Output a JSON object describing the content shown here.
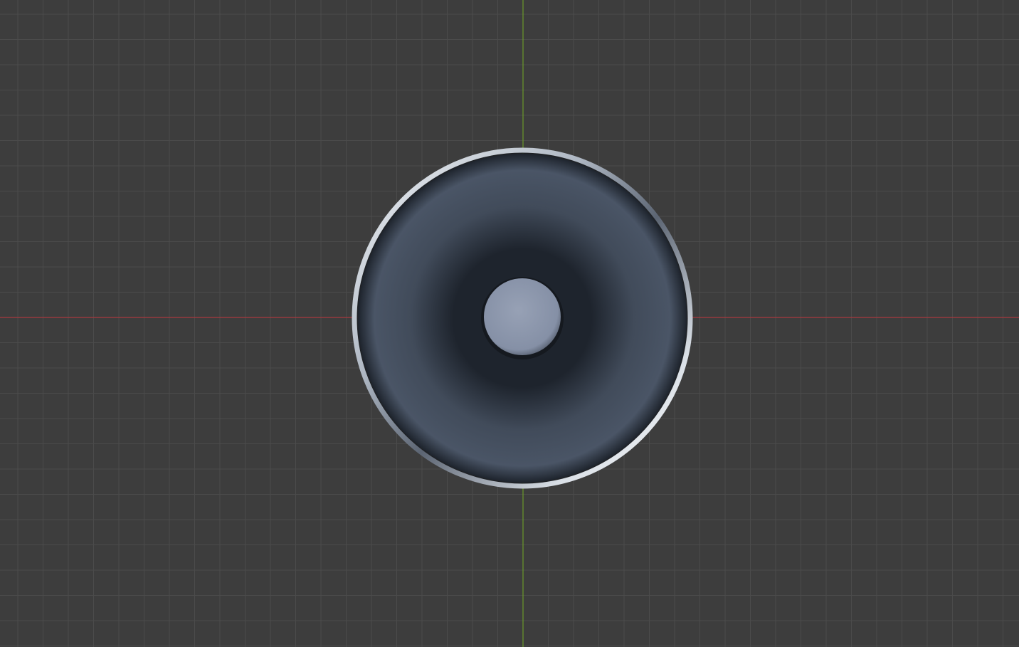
{
  "viewport": {
    "view": "top-orthographic",
    "background_color": "#3d3d3d",
    "grid": {
      "visible": true,
      "line_color": "#4b4b4b",
      "x_axis_color": "#a8393f",
      "y_axis_color": "#6a9a2a"
    },
    "object": {
      "shape": "speaker-cone",
      "cone_color": "#414b5a",
      "cone_shadow_color": "#1e242d",
      "rim_color": "#c9d0da",
      "dust_cap_color": "#8590a6"
    }
  }
}
